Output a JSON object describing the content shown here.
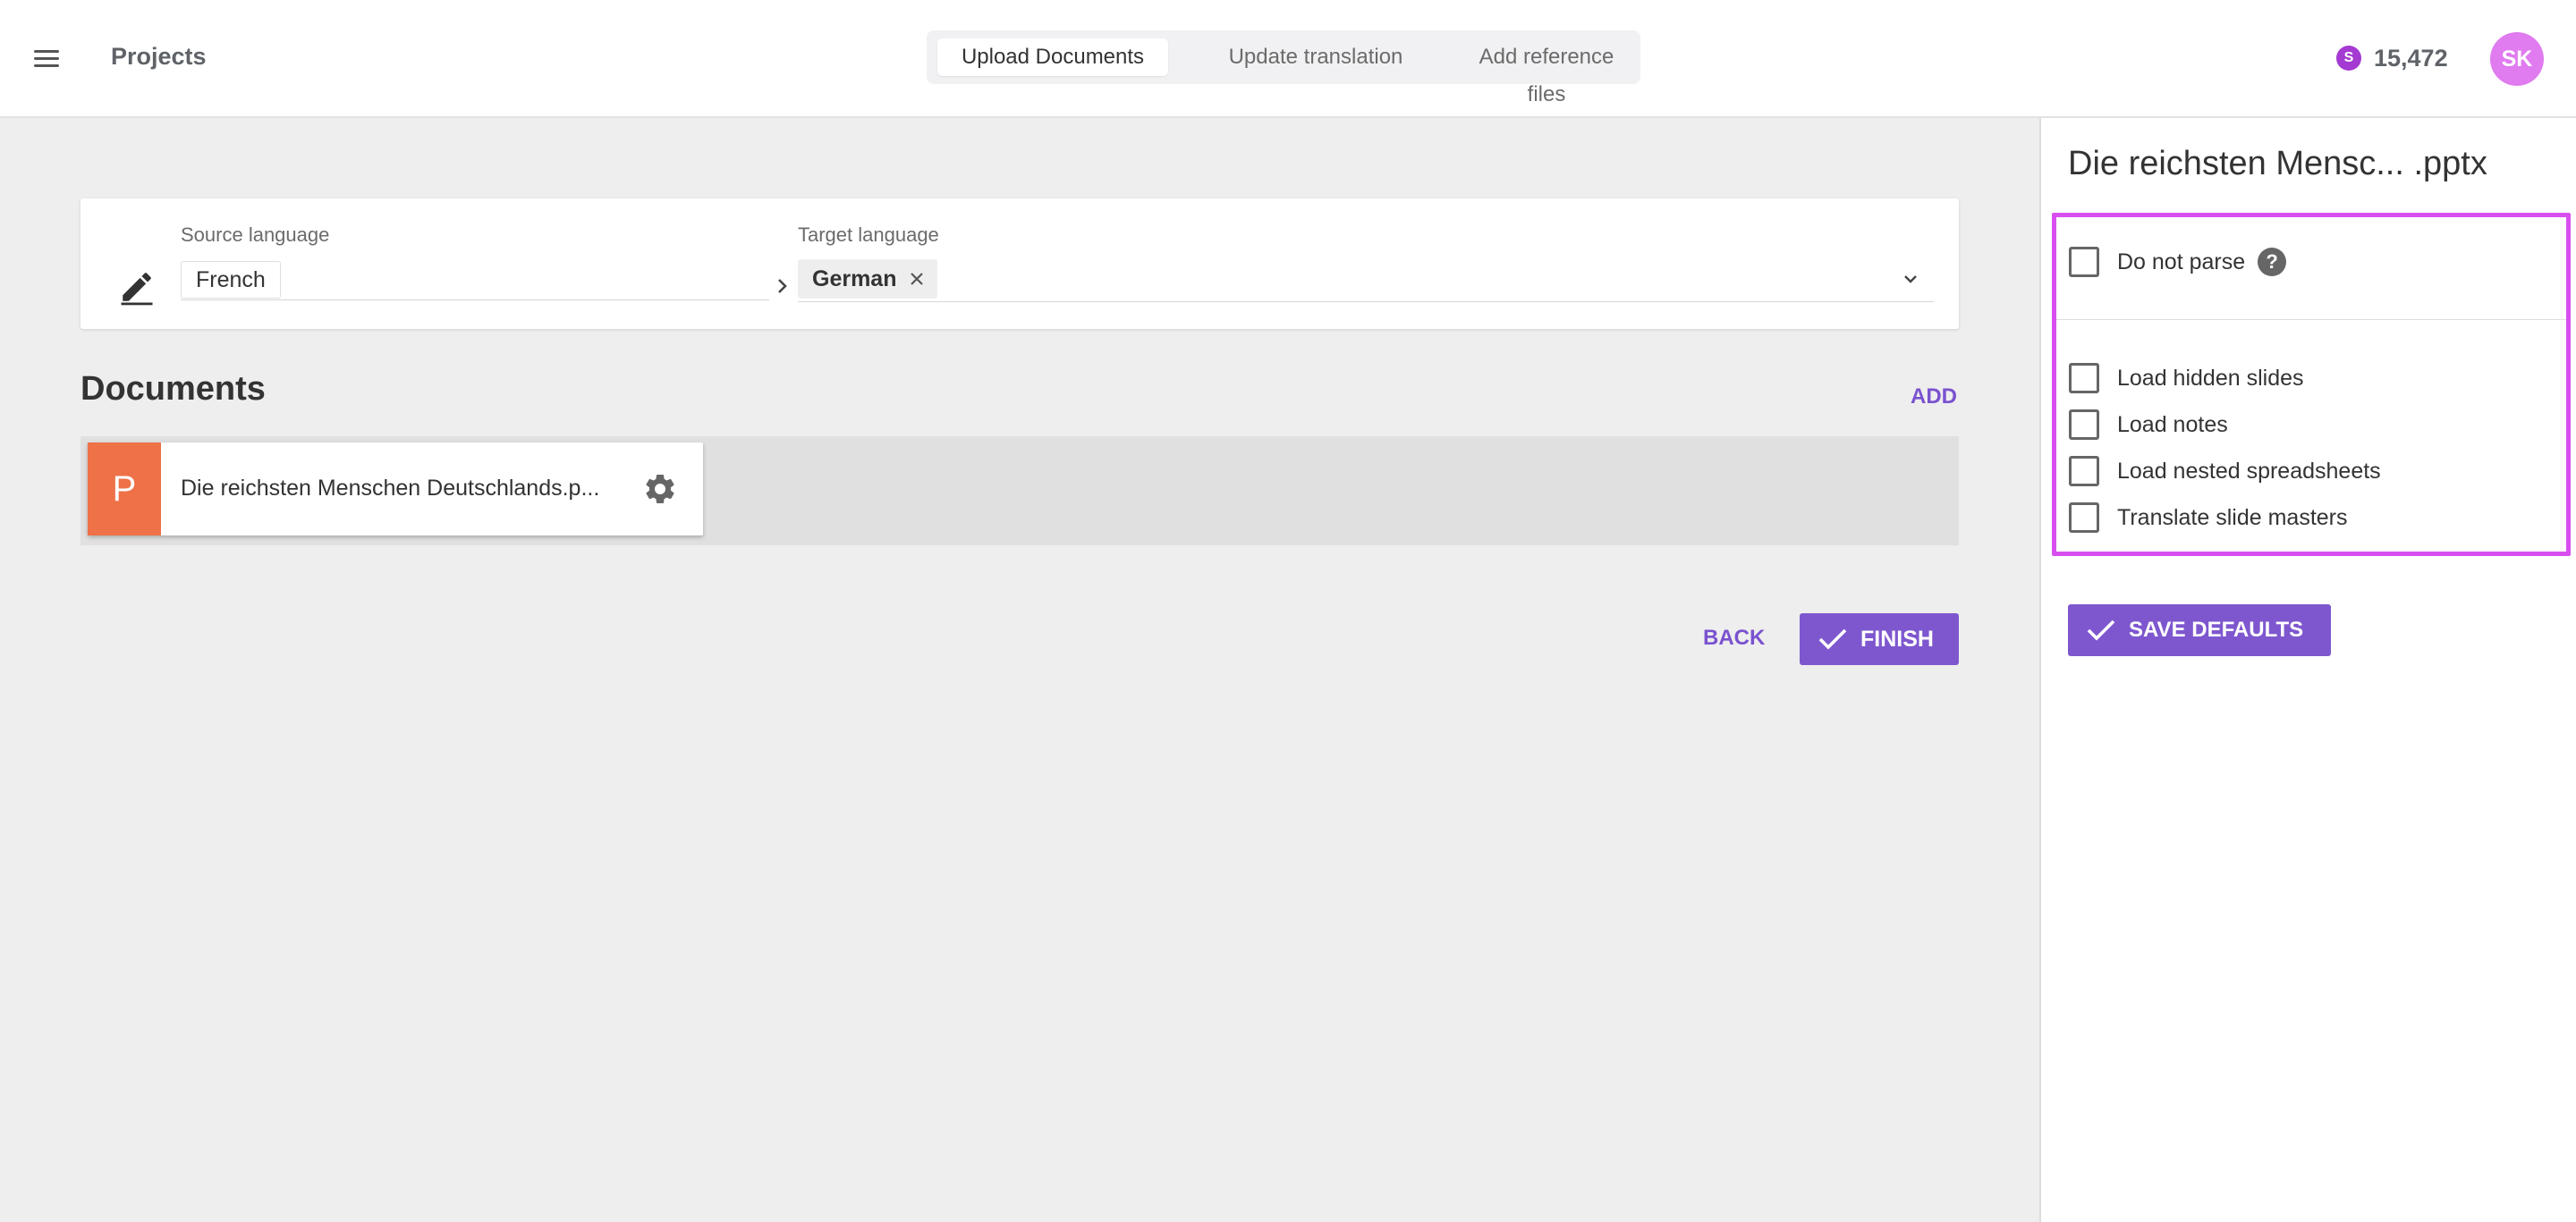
{
  "header": {
    "app_title": "Projects",
    "menu_icon": "hamburger-menu-icon",
    "tabs": [
      {
        "label": "Upload Documents",
        "active": true
      },
      {
        "label": "Update translation",
        "active": false
      },
      {
        "label": "Add reference files",
        "active": false
      }
    ],
    "credits": {
      "icon_letter": "S",
      "value": "15,472"
    },
    "avatar_initials": "SK"
  },
  "languages": {
    "source_label": "Source language",
    "source_value": "French",
    "target_label": "Target language",
    "target_chips": [
      "German"
    ]
  },
  "documents": {
    "title": "Documents",
    "add_label": "ADD",
    "items": [
      {
        "badge": "P",
        "name": "Die reichsten Menschen Deutschlands.p...",
        "badge_color": "#ee7148"
      }
    ]
  },
  "actions": {
    "back_label": "BACK",
    "finish_label": "FINISH"
  },
  "side_panel": {
    "title": "Die reichsten Mensc... .pptx",
    "options": [
      {
        "label": "Do not parse",
        "checked": false
      },
      {
        "label": "Load hidden slides",
        "checked": false
      },
      {
        "label": "Load notes",
        "checked": false
      },
      {
        "label": "Load nested spreadsheets",
        "checked": false
      },
      {
        "label": "Translate slide masters",
        "checked": false
      }
    ],
    "help_glyph": "?",
    "save_defaults_label": "SAVE DEFAULTS",
    "highlight_color": "#d84ff0"
  },
  "colors": {
    "accent": "#7e57cf",
    "avatar": "#e07bf0",
    "coin": "#a43ad2"
  }
}
